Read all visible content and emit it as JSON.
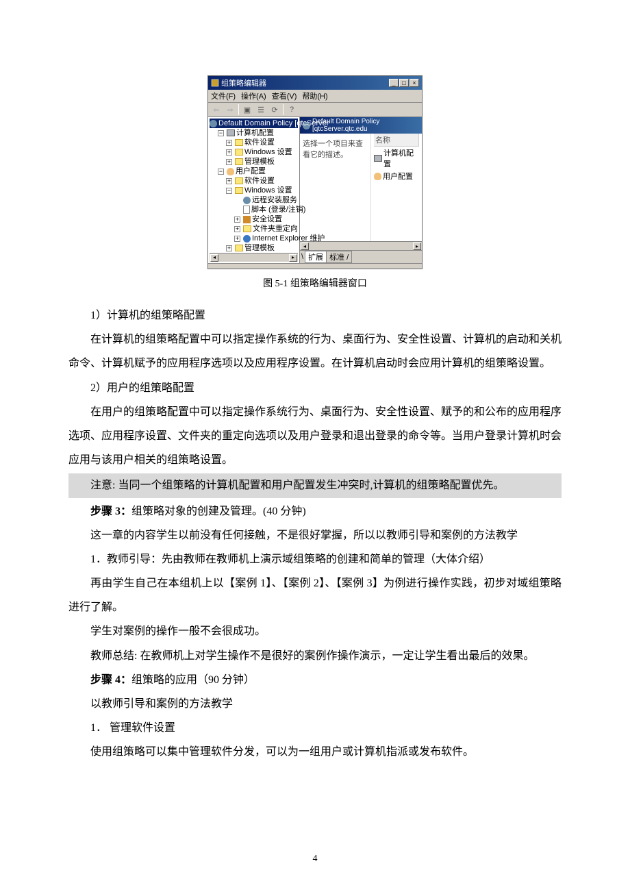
{
  "window": {
    "title": "组策略编辑器",
    "menus": [
      "文件(F)",
      "操作(A)",
      "查看(V)",
      "帮助(H)"
    ],
    "tree_root": "Default Domain Policy [qtcServer",
    "computer_config": "计算机配置",
    "software_settings": "软件设置",
    "windows_settings": "Windows 设置",
    "admin_templates": "管理模板",
    "user_config": "用户配置",
    "remote_install": "远程安装服务",
    "scripts": "脚本 (登录/注销)",
    "security_settings": "安全设置",
    "folder_redirect": "文件夹重定向",
    "ie_maint": "Internet Explorer 维护",
    "right_title": "Default Domain Policy [qtcServer.qtc.edu",
    "right_desc": "选择一个项目来查看它的描述。",
    "col_name": "名称",
    "tab_ext": "扩展",
    "tab_std": "标准"
  },
  "caption": "图 5-1  组策略编辑器窗口",
  "h1": "1）计算机的组策略配置",
  "p1": "在计算机的组策略配置中可以指定操作系统的行为、桌面行为、安全性设置、计算机的启动和关机命令、计算机赋予的应用程序选项以及应用程序设置。在计算机启动时会应用计算机的组策略设置。",
  "h2": "2）用户的组策略配置",
  "p2": "在用户的组策略配置中可以指定操作系统行为、桌面行为、安全性设置、赋予的和公布的应用程序选项、应用程序设置、文件夹的重定向选项以及用户登录和退出登录的命令等。当用户登录计算机时会应用与该用户相关的组策略设置。",
  "notice": "注意: 当同一个组策略的计算机配置和用户配置发生冲突时,计算机的组策略配置优先。",
  "step3_label": "步骤 3：",
  "step3_text": "组策略对象的创建及管理。(40 分钟)",
  "p3": "这一章的内容学生以前没有任何接触，不是很好掌握，所以以教师引导和案例的方法教学",
  "p4": "1．教师引导：先由教师在教师机上演示域组策略的创建和简单的管理（大体介绍）",
  "p5": "再由学生自己在本组机上以【案例 1】、【案例 2】、【案例 3】为例进行操作实践，初步对域组策略进行了解。",
  "p6": "学生对案例的操作一般不会很成功。",
  "p7": "教师总结: 在教师机上对学生操作不是很好的案例作操作演示，一定让学生看出最后的效果。",
  "step4_label": "步骤 4：",
  "step4_text": "组策略的应用（90 分钟）",
  "p8": "以教师引导和案例的方法教学",
  "p9": "1． 管理软件设置",
  "p10": "使用组策略可以集中管理软件分发，可以为一组用户或计算机指派或发布软件。",
  "page_number": "4"
}
